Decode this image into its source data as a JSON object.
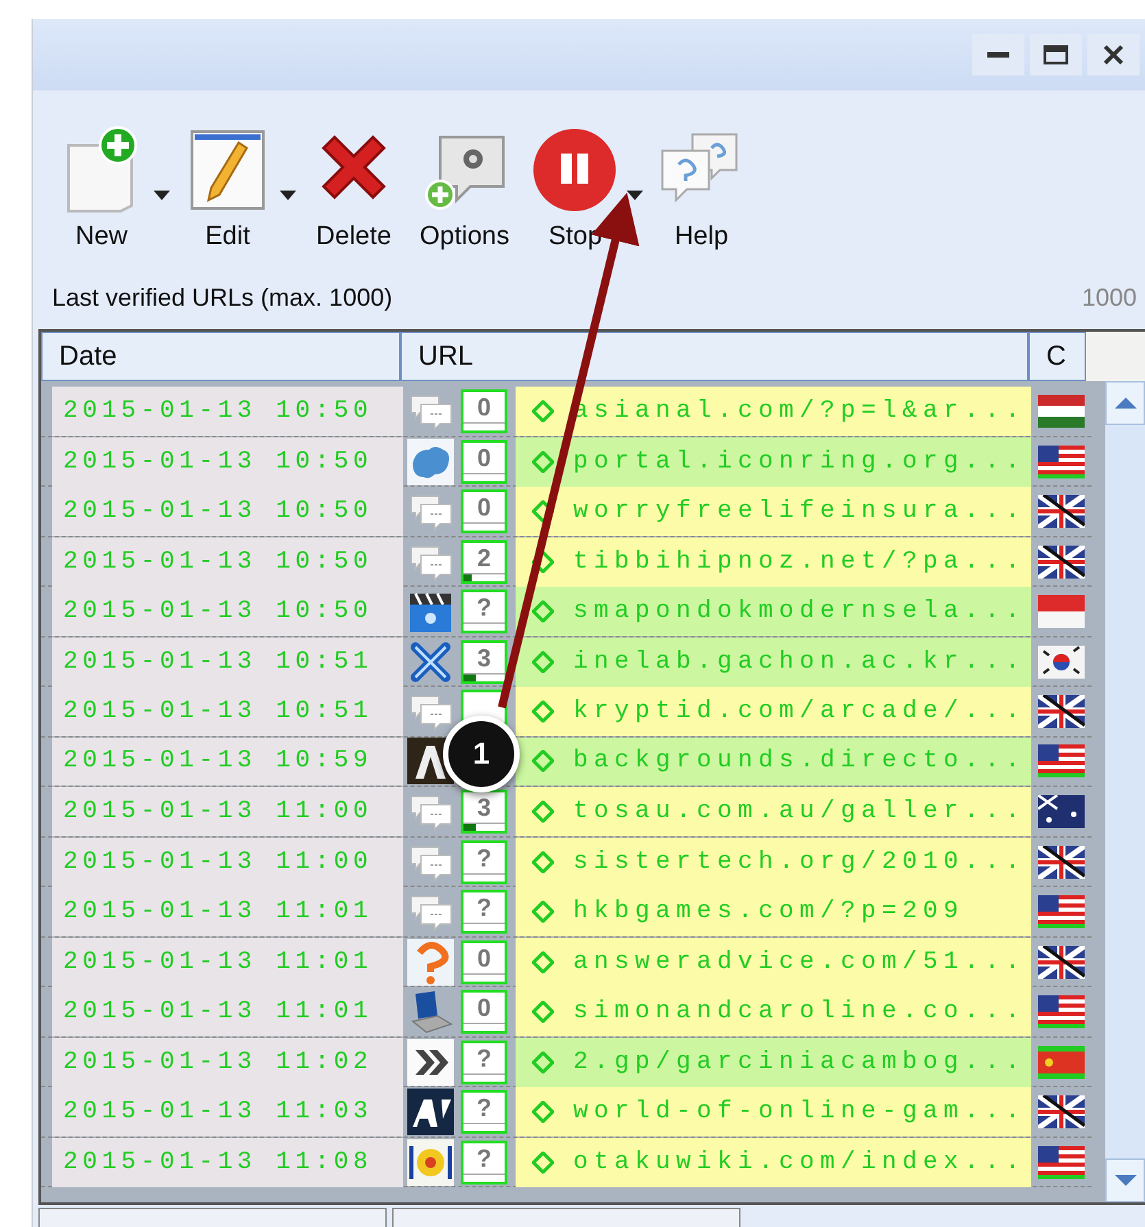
{
  "toolbar": [
    {
      "kind": "new",
      "label": "New",
      "has_menu": true
    },
    {
      "kind": "edit",
      "label": "Edit",
      "has_menu": true
    },
    {
      "kind": "delete",
      "label": "Delete",
      "has_menu": false
    },
    {
      "kind": "options",
      "label": "Options",
      "has_menu": false
    },
    {
      "kind": "stop",
      "label": "Stop",
      "has_menu": true
    },
    {
      "kind": "help",
      "label": "Help",
      "has_menu": false
    }
  ],
  "list_title": "Last verified URLs (max. 1000)",
  "list_count": "1000",
  "table": {
    "columns": [
      "Date",
      "URL",
      "C"
    ],
    "rows": [
      {
        "date": "2015-01-13 10:50",
        "favicon": {
          "kind": "chat"
        },
        "count": "0",
        "level": 0,
        "url": "asianal.com/?p=l&ar...",
        "highlighted": false,
        "flag": {
          "kind": "hungary"
        }
      },
      {
        "date": "2015-01-13 10:50",
        "favicon": {
          "kind": "cloud"
        },
        "count": "0",
        "level": 0,
        "url": "portal.iconring.org...",
        "highlighted": true,
        "flag": {
          "kind": "usa"
        }
      },
      {
        "date": "2015-01-13 10:50",
        "favicon": {
          "kind": "chat"
        },
        "count": "0",
        "level": 0,
        "url": "worryfreelifeinsura...",
        "highlighted": false,
        "flag": {
          "kind": "uk"
        }
      },
      {
        "date": "2015-01-13 10:50",
        "favicon": {
          "kind": "chat"
        },
        "count": "2",
        "level": 0.2,
        "url": "tibbihipnoz.net/?pa...",
        "highlighted": false,
        "flag": {
          "kind": "uk"
        }
      },
      {
        "date": "2015-01-13 10:50",
        "favicon": {
          "kind": "clapper"
        },
        "count": "?",
        "level": 0,
        "url": "smapondokmodernsela...",
        "highlighted": true,
        "flag": {
          "kind": "indonesia"
        }
      },
      {
        "date": "2015-01-13 10:51",
        "favicon": {
          "kind": "cross"
        },
        "count": "3",
        "level": 0.3,
        "url": "inelab.gachon.ac.kr...",
        "highlighted": true,
        "flag": {
          "kind": "korea"
        }
      },
      {
        "date": "2015-01-13 10:51",
        "favicon": {
          "kind": "chat"
        },
        "level": 0,
        "url": "kryptid.com/arcade/...",
        "highlighted": false,
        "flag": {
          "kind": "uk"
        }
      },
      {
        "date": "2015-01-13 10:59",
        "favicon": {
          "kind": "block"
        },
        "url": "backgrounds.directo...",
        "highlighted": true,
        "flag": {
          "kind": "usa"
        }
      },
      {
        "date": "2015-01-13 11:00",
        "favicon": {
          "kind": "chat"
        },
        "count": "3",
        "level": 0.3,
        "url": "tosau.com.au/galler...",
        "highlighted": false,
        "flag": {
          "kind": "australia"
        }
      },
      {
        "date": "2015-01-13 11:00",
        "favicon": {
          "kind": "chat"
        },
        "count": "?",
        "level": 0,
        "url": "sistertech.org/2010...",
        "highlighted": false,
        "flag": {
          "kind": "uk"
        }
      },
      {
        "date": "2015-01-13 11:01",
        "favicon": {
          "kind": "chat"
        },
        "count": "?",
        "level": 0,
        "url": "hkbgames.com/?p=209",
        "highlighted": false,
        "flag": {
          "kind": "usa"
        }
      },
      {
        "date": "2015-01-13 11:01",
        "favicon": {
          "kind": "question"
        },
        "count": "0",
        "level": 0,
        "url": "answeradvice.com/51...",
        "highlighted": false,
        "flag": {
          "kind": "uk"
        }
      },
      {
        "date": "2015-01-13 11:01",
        "favicon": {
          "kind": "laptop"
        },
        "count": "0",
        "level": 0,
        "url": "simonandcaroline.co...",
        "highlighted": false,
        "flag": {
          "kind": "usa"
        }
      },
      {
        "date": "2015-01-13 11:02",
        "favicon": {
          "kind": "chevrons"
        },
        "count": "?",
        "level": 0,
        "url": "2.gp/garciniacambog...",
        "highlighted": true,
        "flag": {
          "kind": "china"
        }
      },
      {
        "date": "2015-01-13 11:03",
        "favicon": {
          "kind": "av"
        },
        "count": "?",
        "level": 0,
        "url": "world-of-online-gam...",
        "highlighted": false,
        "flag": {
          "kind": "uk"
        }
      },
      {
        "date": "2015-01-13 11:08",
        "favicon": {
          "kind": "sun"
        },
        "count": "?",
        "level": 0,
        "url": "otakuwiki.com/index...",
        "highlighted": false,
        "flag": {
          "kind": "usa"
        }
      }
    ]
  },
  "callout": {
    "label": "1"
  }
}
